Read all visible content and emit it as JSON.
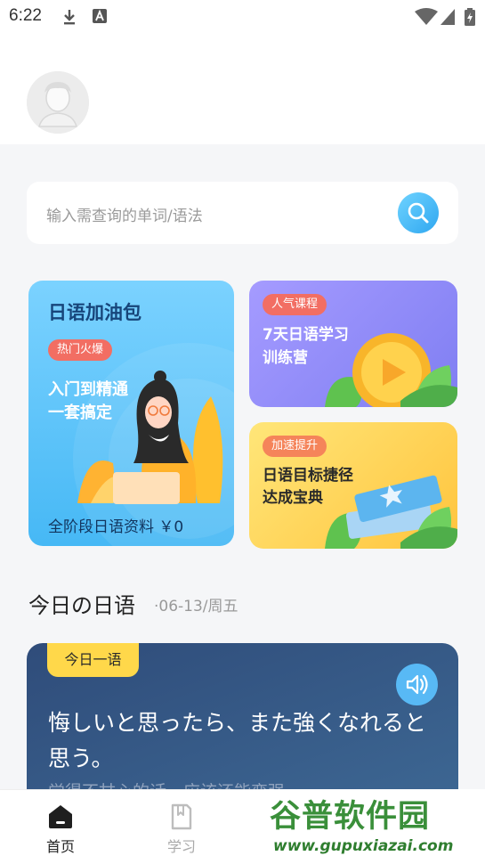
{
  "status_bar": {
    "time": "6:22"
  },
  "search": {
    "placeholder": "输入需查询的单词/语法"
  },
  "cards": {
    "main": {
      "title": "日语加油包",
      "tag": "热门火爆",
      "subtitle_line1": "入门到精通",
      "subtitle_line2": "一套搞定",
      "footer": "全阶段日语资料 ￥0"
    },
    "top_right": {
      "tag": "人气课程",
      "line1": "7天日语学习",
      "line2": "训练营"
    },
    "bottom_right": {
      "tag": "加速提升",
      "line1": "日语目标捷径",
      "line2": "达成宝典"
    }
  },
  "daily": {
    "section_title": "今日の日语",
    "date": "·06-13/周五",
    "tag": "今日一语",
    "quote": "悔しいと思ったら、また強くなれると思う。",
    "translation_partial": "觉得不甘心的话，应该还能变强"
  },
  "tabs": [
    {
      "label": "首页",
      "active": true
    },
    {
      "label": "学习",
      "active": false
    }
  ],
  "watermark": {
    "name": "谷普软件园",
    "url": "www.gupuxiazai.com"
  },
  "colors": {
    "accent": "#2fa7f0",
    "quote_bg": "#2f4c7a",
    "tag_yellow": "#ffd84a"
  }
}
